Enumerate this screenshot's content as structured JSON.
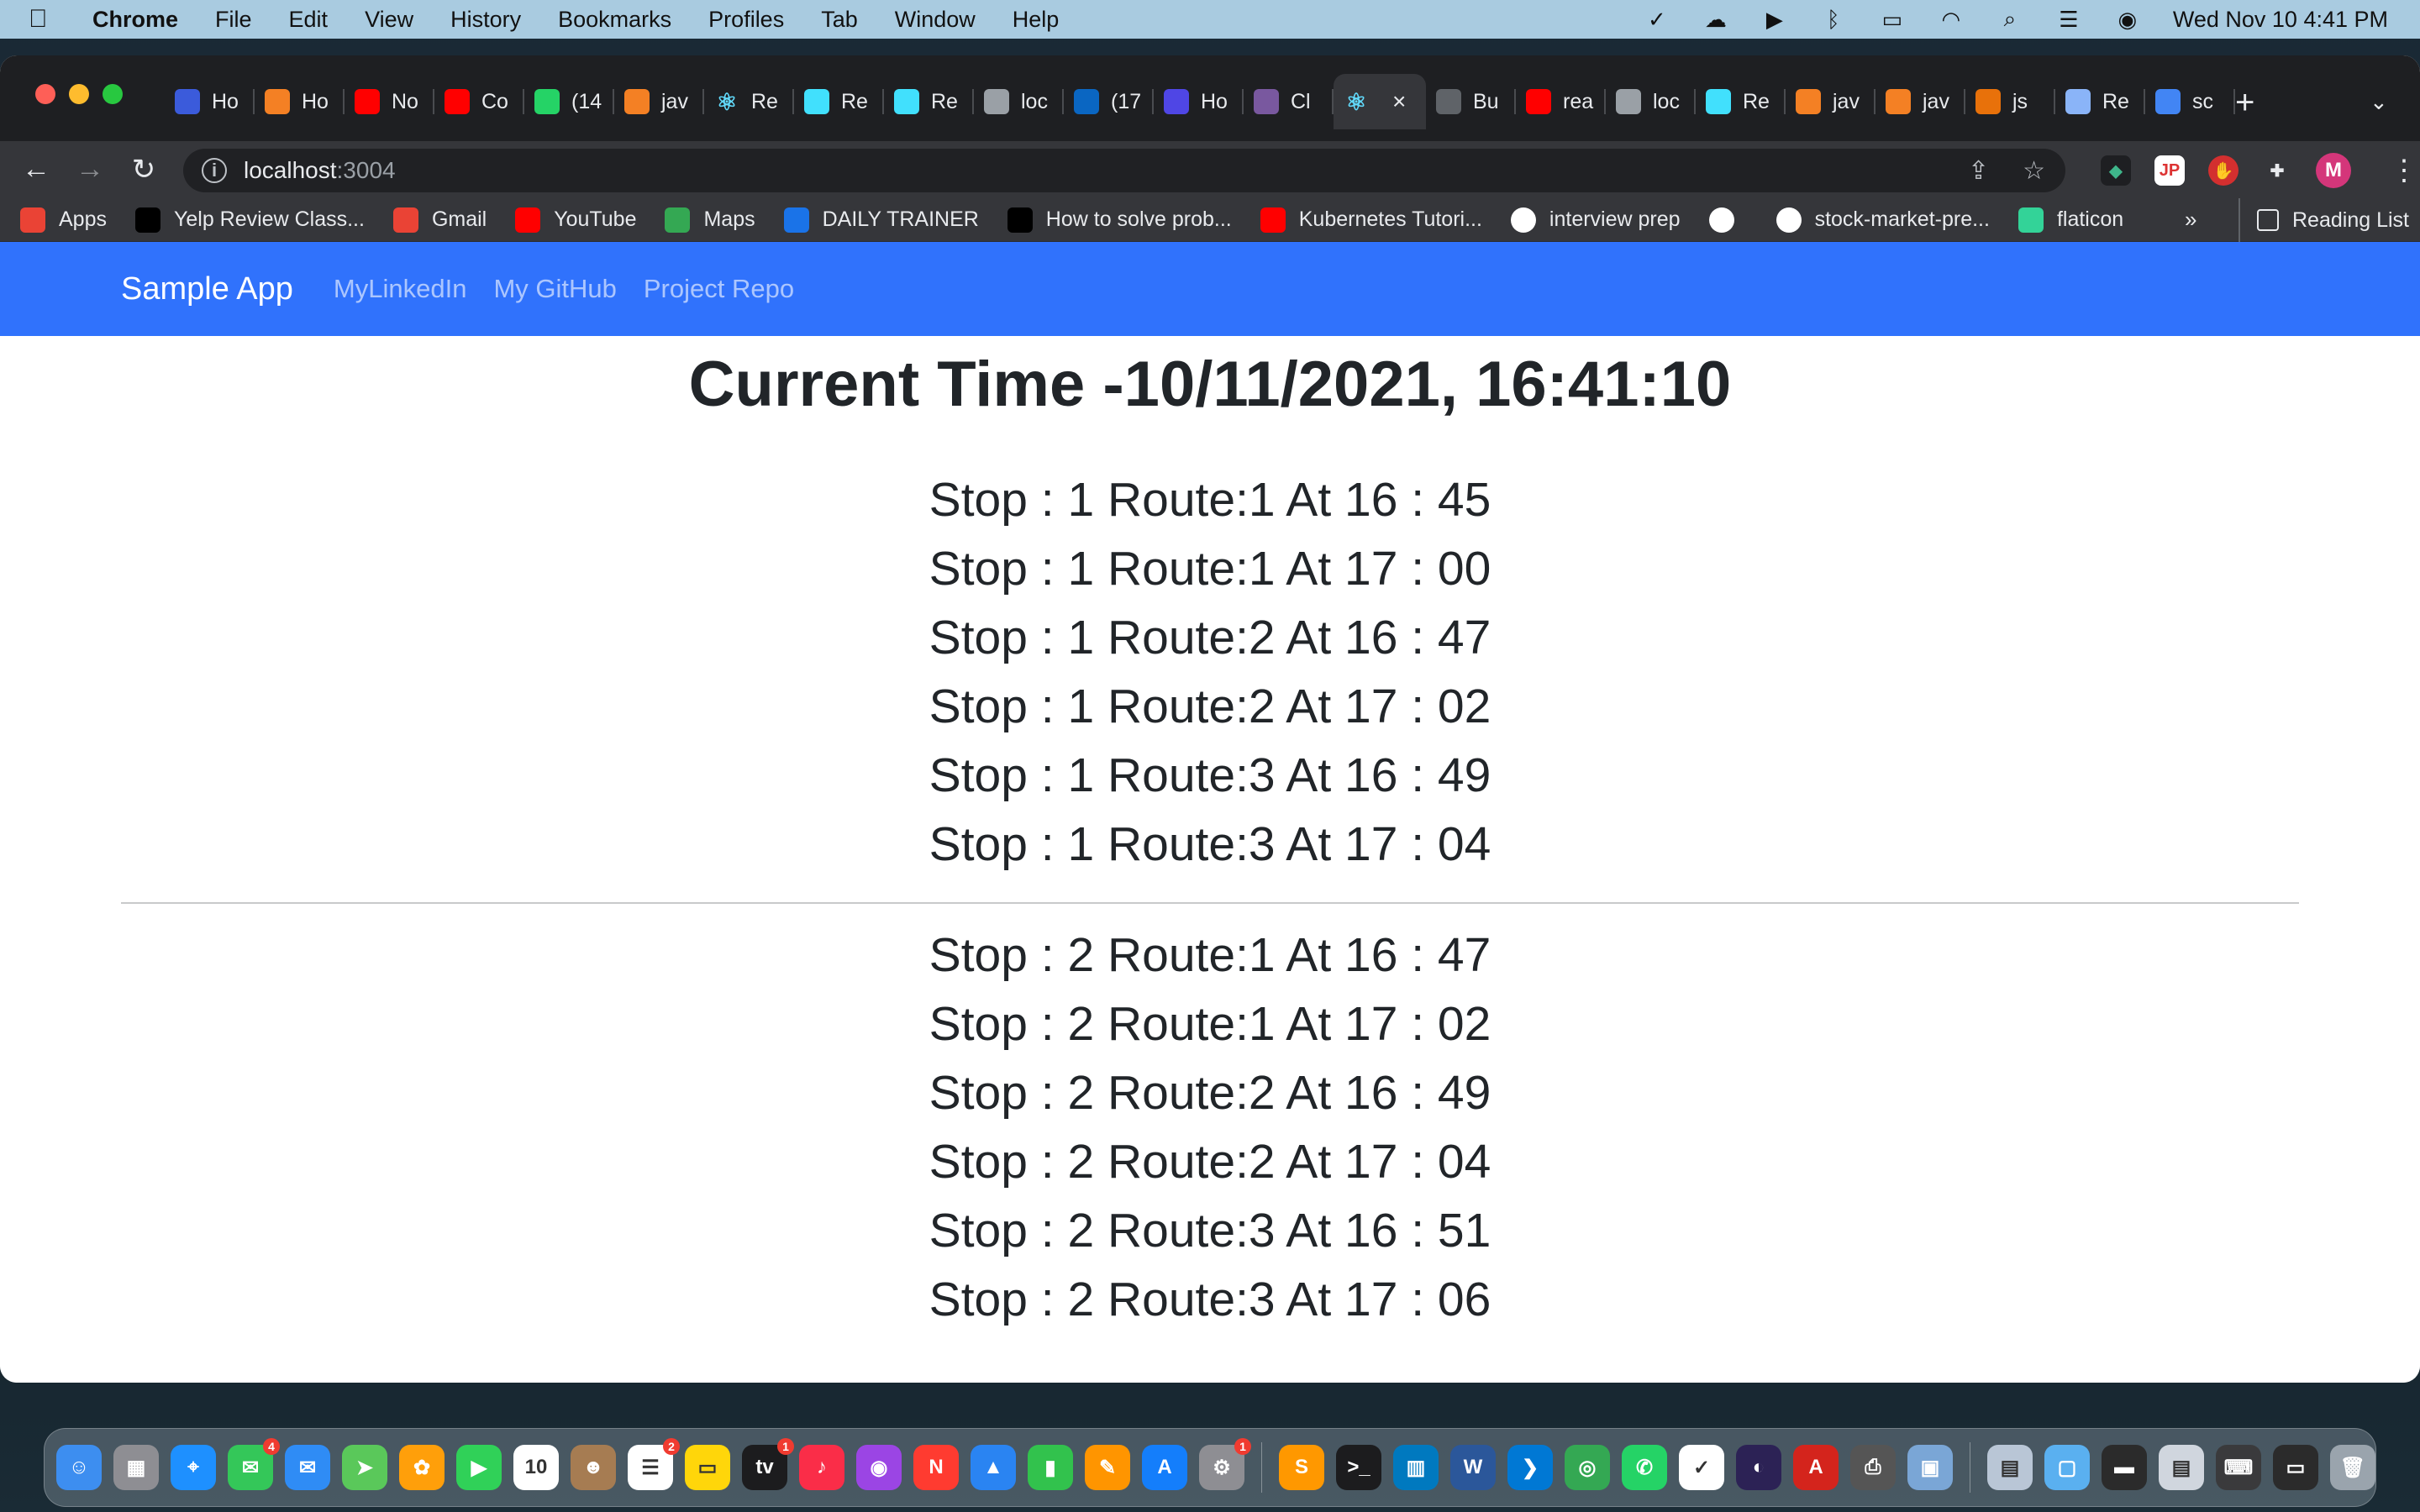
{
  "menubar": {
    "apple_icon": "apple-icon",
    "app_name": "Chrome",
    "menus": [
      "File",
      "Edit",
      "View",
      "History",
      "Bookmarks",
      "Profiles",
      "Tab",
      "Window",
      "Help"
    ],
    "clock": "Wed Nov 10  4:41 PM"
  },
  "browser": {
    "tabs": [
      {
        "label": "Ho",
        "icon": "bootstrap-icon",
        "color": "#3b5bdb"
      },
      {
        "label": "Ho",
        "icon": "stackoverflow-icon",
        "color": "#f48024"
      },
      {
        "label": "No",
        "icon": "youtube-icon",
        "color": "#ff0000"
      },
      {
        "label": "Co",
        "icon": "youtube-icon",
        "color": "#ff0000"
      },
      {
        "label": "(14",
        "icon": "whatsapp-icon",
        "color": "#25d366"
      },
      {
        "label": "jav",
        "icon": "stackoverflow-icon",
        "color": "#f48024"
      },
      {
        "label": "Re",
        "icon": "react-icon",
        "color": "#61dafb"
      },
      {
        "label": "Re",
        "icon": "react-bootstrap-icon",
        "color": "#41e0fd"
      },
      {
        "label": "Re",
        "icon": "react-bootstrap-icon",
        "color": "#41e0fd"
      },
      {
        "label": "loc",
        "icon": "globe-icon",
        "color": "#9aa0a6"
      },
      {
        "label": "(17",
        "icon": "linkedin-icon",
        "color": "#0a66c2"
      },
      {
        "label": "Ho",
        "icon": "aws-icon",
        "color": "#4f46e5"
      },
      {
        "label": "Cl",
        "icon": "heroku-icon",
        "color": "#79589f"
      }
    ],
    "active_tab": {
      "label": "",
      "icon": "react-icon"
    },
    "tabs_after": [
      {
        "label": "Bu",
        "icon": "table-icon",
        "color": "#5f6368"
      },
      {
        "label": "rea",
        "icon": "youtube-icon",
        "color": "#ff0000"
      },
      {
        "label": "loc",
        "icon": "globe-icon",
        "color": "#9aa0a6"
      },
      {
        "label": "Re",
        "icon": "react-bootstrap-icon",
        "color": "#41e0fd"
      },
      {
        "label": "jav",
        "icon": "stackoverflow-icon",
        "color": "#f48024"
      },
      {
        "label": "jav",
        "icon": "stackoverflow-icon",
        "color": "#f48024"
      },
      {
        "label": "js",
        "icon": "sparkle-icon",
        "color": "#e8710a"
      },
      {
        "label": "Re",
        "icon": "chat-icon",
        "color": "#8ab4f8"
      },
      {
        "label": "sc",
        "icon": "google-icon",
        "color": "#4285f4"
      }
    ],
    "url_host": "localhost",
    "url_port": ":3004",
    "profile_initial": "M"
  },
  "bookmarks": [
    {
      "label": "Apps",
      "icon": "apps-grid-icon",
      "color": "#ea4335"
    },
    {
      "label": "Yelp Review Class...",
      "icon": "medium-icon",
      "color": "#000000"
    },
    {
      "label": "Gmail",
      "icon": "gmail-icon",
      "color": "#ea4335"
    },
    {
      "label": "YouTube",
      "icon": "youtube-icon",
      "color": "#ff0000"
    },
    {
      "label": "Maps",
      "icon": "maps-icon",
      "color": "#34a853"
    },
    {
      "label": "DAILY TRAINER",
      "icon": "trainer-icon",
      "color": "#1a73e8"
    },
    {
      "label": "How to solve prob...",
      "icon": "medium-icon",
      "color": "#000000"
    },
    {
      "label": "Kubernetes Tutori...",
      "icon": "youtube-icon",
      "color": "#ff0000"
    },
    {
      "label": "interview prep",
      "icon": "github-icon",
      "color": "#ffffff"
    },
    {
      "label": "",
      "icon": "globe-icon",
      "color": "#ffffff"
    },
    {
      "label": "stock-market-pre...",
      "icon": "github-icon",
      "color": "#ffffff"
    },
    {
      "label": "flaticon",
      "icon": "flaticon-icon",
      "color": "#33d398"
    }
  ],
  "bookmarks_more": "»",
  "reading_list": "Reading List",
  "app": {
    "brand": "Sample App",
    "nav_links": [
      "MyLinkedIn",
      "My GitHub",
      "Project Repo"
    ],
    "time_heading": "Current Time -10/11/2021, 16:41:10",
    "stop_groups": [
      [
        "Stop : 1 Route:1 At 16 : 45",
        "Stop : 1 Route:1 At 17 : 00",
        "Stop : 1 Route:2 At 16 : 47",
        "Stop : 1 Route:2 At 17 : 02",
        "Stop : 1 Route:3 At 16 : 49",
        "Stop : 1 Route:3 At 17 : 04"
      ],
      [
        "Stop : 2 Route:1 At 16 : 47",
        "Stop : 2 Route:1 At 17 : 02",
        "Stop : 2 Route:2 At 16 : 49",
        "Stop : 2 Route:2 At 17 : 04",
        "Stop : 2 Route:3 At 16 : 51",
        "Stop : 2 Route:3 At 17 : 06"
      ]
    ],
    "colors": {
      "navbar": "#3072fc",
      "text": "#212529"
    }
  },
  "dock": [
    {
      "name": "finder-icon",
      "color": "#3d8ef0",
      "glyph": "☺"
    },
    {
      "name": "launchpad-icon",
      "color": "#8e8e93",
      "glyph": "▦"
    },
    {
      "name": "safari-icon",
      "color": "#1e90ff",
      "glyph": "⌖"
    },
    {
      "name": "messages-icon",
      "color": "#34c759",
      "glyph": "✉",
      "badge": "4"
    },
    {
      "name": "mail-icon",
      "color": "#2f8cf5",
      "glyph": "✉"
    },
    {
      "name": "maps-icon",
      "color": "#5ac85a",
      "glyph": "➤"
    },
    {
      "name": "photos-icon",
      "color": "#ff9f0a",
      "glyph": "✿"
    },
    {
      "name": "facetime-icon",
      "color": "#30d158",
      "glyph": "▶"
    },
    {
      "name": "calendar-icon",
      "color": "#ffffff",
      "glyph": "10"
    },
    {
      "name": "contacts-icon",
      "color": "#a67c52",
      "glyph": "☻"
    },
    {
      "name": "reminders-icon",
      "color": "#ffffff",
      "glyph": "☰",
      "badge": "2"
    },
    {
      "name": "notes-icon",
      "color": "#ffd60a",
      "glyph": "▭"
    },
    {
      "name": "tv-icon",
      "color": "#1c1c1e",
      "glyph": "tv",
      "badge": "1"
    },
    {
      "name": "music-icon",
      "color": "#fa2d48",
      "glyph": "♪"
    },
    {
      "name": "podcasts-icon",
      "color": "#9b45e4",
      "glyph": "◉"
    },
    {
      "name": "news-icon",
      "color": "#ff3b30",
      "glyph": "N"
    },
    {
      "name": "keynote-icon",
      "color": "#2a84f2",
      "glyph": "▲"
    },
    {
      "name": "numbers-icon",
      "color": "#32c24d",
      "glyph": "▮"
    },
    {
      "name": "pages-icon",
      "color": "#ff9500",
      "glyph": "✎"
    },
    {
      "name": "app-store-icon",
      "color": "#147efb",
      "glyph": "A"
    },
    {
      "name": "system-preferences-icon",
      "color": "#8e8e93",
      "glyph": "⚙",
      "badge": "1"
    },
    {
      "name": "sublime-icon",
      "color": "#ff9800",
      "glyph": "S"
    },
    {
      "name": "terminal-icon",
      "color": "#1c1c1e",
      "glyph": ">_"
    },
    {
      "name": "trello-icon",
      "color": "#0079bf",
      "glyph": "▥"
    },
    {
      "name": "word-icon",
      "color": "#2b579a",
      "glyph": "W"
    },
    {
      "name": "vscode-icon",
      "color": "#0078d4",
      "glyph": "❯"
    },
    {
      "name": "chrome-icon",
      "color": "#34a853",
      "glyph": "◎"
    },
    {
      "name": "whatsapp-icon",
      "color": "#25d366",
      "glyph": "✆"
    },
    {
      "name": "tasks-icon",
      "color": "#ffffff",
      "glyph": "✓"
    },
    {
      "name": "eclipse-icon",
      "color": "#2c2255",
      "glyph": "◐"
    },
    {
      "name": "acrobat-icon",
      "color": "#d4241c",
      "glyph": "A"
    },
    {
      "name": "printer-icon",
      "color": "#555555",
      "glyph": "⎙"
    },
    {
      "name": "preview-icon",
      "color": "#7aa6d6",
      "glyph": "▣"
    },
    {
      "name": "downloads-folder-icon",
      "color": "#b9c6d6",
      "glyph": "▤"
    },
    {
      "name": "screenshot-icon",
      "color": "#5ab0f0",
      "glyph": "▢"
    },
    {
      "name": "terminal-window-icon",
      "color": "#2b2b2b",
      "glyph": "▬"
    },
    {
      "name": "document-icon",
      "color": "#d0d6de",
      "glyph": "▤"
    },
    {
      "name": "keyboard-icon",
      "color": "#3a3a3c",
      "glyph": "⌨"
    },
    {
      "name": "window-icon",
      "color": "#2b2b2b",
      "glyph": "▭"
    },
    {
      "name": "trash-icon",
      "color": "#9aa4ad",
      "glyph": "🗑"
    }
  ]
}
